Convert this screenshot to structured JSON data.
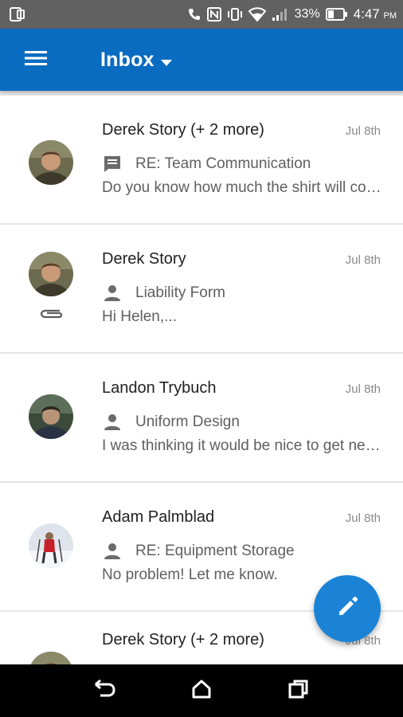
{
  "status_bar": {
    "battery": "33%",
    "time": "4:47",
    "ampm": "PM"
  },
  "app_bar": {
    "title": "Inbox",
    "icons": [
      "menu-icon",
      "dropdown-arrow-icon"
    ]
  },
  "messages": [
    {
      "sender": "Derek Story (+ 2 more)",
      "date": "Jul 8th",
      "subject": "RE: Team Communication",
      "preview": "Do you know how much the shirt will cost?",
      "subject_icon": "conversation-icon",
      "has_attachment": false
    },
    {
      "sender": "Derek Story",
      "date": "Jul 8th",
      "subject": "Liability Form",
      "preview": "Hi Helen,...",
      "subject_icon": "person-icon",
      "has_attachment": true
    },
    {
      "sender": "Landon Trybuch",
      "date": "Jul 8th",
      "subject": "Uniform Design",
      "preview": "I was thinking it would be nice to get new uniforms",
      "subject_icon": "person-icon",
      "has_attachment": false
    },
    {
      "sender": "Adam Palmblad",
      "date": "Jul 8th",
      "subject": "RE: Equipment Storage",
      "preview": "No problem! Let me know.",
      "subject_icon": "person-icon",
      "has_attachment": false
    },
    {
      "sender": "Derek Story (+ 2 more)",
      "date": "Jul 8th",
      "subject": "",
      "preview": "",
      "subject_icon": "",
      "has_attachment": false
    }
  ],
  "fab": {
    "icon": "pencil-icon"
  },
  "colors": {
    "primary": "#0a6cc0",
    "fab": "#1b83d6",
    "status_bar": "#616161",
    "nav_bar": "#000000"
  }
}
